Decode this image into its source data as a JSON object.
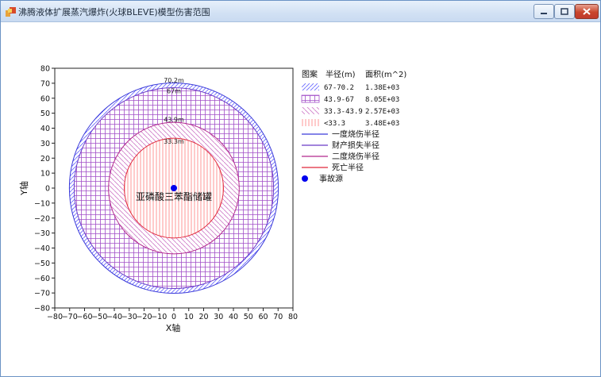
{
  "window": {
    "title": "沸腾液体扩展蒸汽爆炸(火球BLEVE)模型伤害范围"
  },
  "chart_data": {
    "type": "area",
    "xlabel": "X轴",
    "ylabel": "Y轴",
    "xlim": [
      -80,
      80
    ],
    "ylim": [
      -80,
      80
    ],
    "xticks": [
      "-80",
      "-70",
      "-60",
      "-50",
      "-40",
      "-30",
      "-20",
      "-10",
      "0",
      "10",
      "20",
      "30",
      "40",
      "50",
      "60",
      "70",
      "80"
    ],
    "yticks": [
      "80",
      "70",
      "60",
      "50",
      "40",
      "30",
      "20",
      "10",
      "0",
      "-10",
      "-20",
      "-30",
      "-40",
      "-50",
      "-60",
      "-70",
      "-80"
    ],
    "circles": [
      {
        "radius": 70.2,
        "label": "70.2m",
        "color": "#3b3bd9"
      },
      {
        "radius": 67,
        "label": "67m",
        "color": "#6a3bc8"
      },
      {
        "radius": 43.9,
        "label": "43.9m",
        "color": "#b2288e"
      },
      {
        "radius": 33.3,
        "label": "33.3m",
        "color": "#e0283a"
      }
    ],
    "source": {
      "x": 0,
      "y": 0,
      "label": "亚磷酸三苯酯储罐",
      "color": "#0000ee"
    },
    "legend": {
      "headers": [
        "图案",
        "半径(m)",
        "面积(m^2)"
      ],
      "zones": [
        {
          "radius": "67-70.2",
          "area": "1.38E+03"
        },
        {
          "radius": "43.9-67",
          "area": "8.05E+03"
        },
        {
          "radius": "33.3-43.9",
          "area": "2.57E+03"
        },
        {
          "radius": "<33.3",
          "area": "3.48E+03"
        }
      ],
      "lines": [
        {
          "label": "一度烧伤半径",
          "color": "#3b3bd9"
        },
        {
          "label": "财产损失半径",
          "color": "#6a3bc8"
        },
        {
          "label": "二度烧伤半径",
          "color": "#b2288e"
        },
        {
          "label": "死亡半径",
          "color": "#e0283a"
        }
      ],
      "source_label": "事故源"
    }
  }
}
